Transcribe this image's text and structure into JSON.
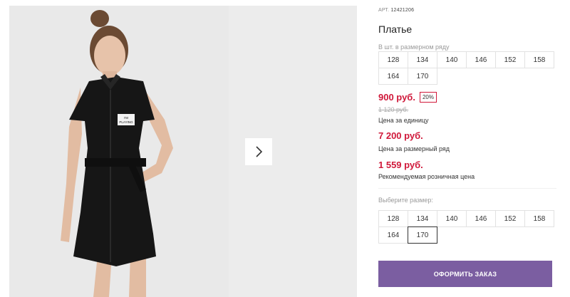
{
  "product": {
    "article_label": "АРТ.",
    "article_number": "12421206",
    "title": "Платье"
  },
  "size_range": {
    "label": "В шт. в размерном ряду",
    "sizes": [
      "128",
      "134",
      "140",
      "146",
      "152",
      "158",
      "164",
      "170"
    ]
  },
  "pricing": {
    "unit_price": "900 руб.",
    "discount": "20%",
    "old_price": "1 120 руб.",
    "unit_price_label": "Цена за единицу",
    "range_price": "7 200 руб.",
    "range_price_label": "Цена за размерный ряд",
    "retail_price": "1 559 руб.",
    "retail_price_label": "Рекомендуемая розничная цена"
  },
  "size_picker": {
    "label": "Выберите размер:",
    "sizes": [
      "128",
      "134",
      "140",
      "146",
      "152",
      "158",
      "164",
      "170"
    ],
    "selected": "170"
  },
  "actions": {
    "order_label": "ОФОРМИТЬ ЗАКАЗ"
  },
  "gallery": {
    "next_icon": "chevron-right-icon",
    "patch_text_1": "I'M",
    "patch_text_2": "PLAYING"
  },
  "colors": {
    "accent_price": "#d0183a",
    "order_button": "#7b5ea1",
    "dress": "#161616"
  }
}
